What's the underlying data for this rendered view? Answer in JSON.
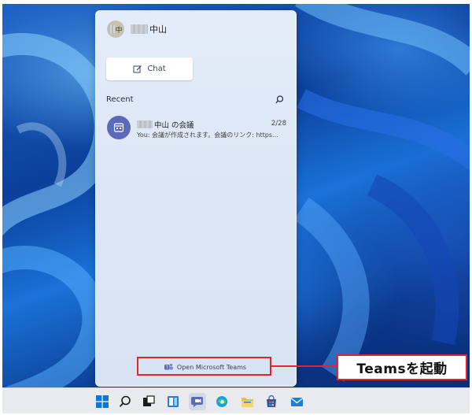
{
  "profile": {
    "avatar_initial": "中",
    "name": "中山"
  },
  "actions": {
    "chat_label": "Chat"
  },
  "recent": {
    "label": "Recent",
    "items": [
      {
        "title": "中山 の会議",
        "date": "2/28",
        "preview": "You: 会議が作成されます。会議のリンク: https..."
      }
    ]
  },
  "footer": {
    "open_teams_label": "Open Microsoft Teams"
  },
  "callout": {
    "text": "Teamsを起動"
  },
  "taskbar": {
    "icons": [
      "windows-start-icon",
      "search-icon",
      "task-view-icon",
      "widgets-icon",
      "teams-chat-icon",
      "edge-icon",
      "file-explorer-icon",
      "store-icon",
      "mail-icon"
    ]
  },
  "colors": {
    "accent_red": "#e0262c",
    "teams_purple": "#5b6ab8"
  }
}
